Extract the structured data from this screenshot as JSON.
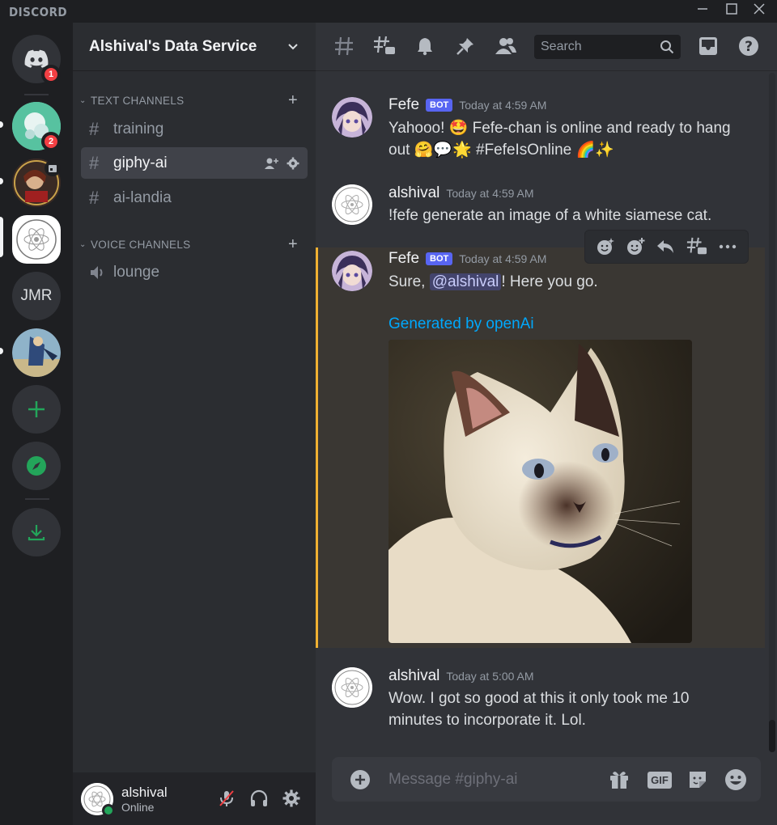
{
  "titlebar": {
    "brand": "DISCORD"
  },
  "servers": {
    "home_badge": "1",
    "server2_badge": "2",
    "jmr_label": "JMR"
  },
  "guild": {
    "name": "Alshival's Data Service"
  },
  "categories": {
    "text": "TEXT CHANNELS",
    "voice": "VOICE CHANNELS"
  },
  "channels": {
    "training": "training",
    "giphy_ai": "giphy-ai",
    "ai_landia": "ai-landia",
    "lounge": "lounge"
  },
  "user": {
    "name": "alshival",
    "status": "Online"
  },
  "topbar": {
    "search_placeholder": "Search"
  },
  "messages": [
    {
      "author": "Fefe",
      "bot": "BOT",
      "time": "Today at 4:59 AM",
      "text": "Yahooo! 🤩 Fefe-chan is online and ready to hang out 🤗💬🌟 #FefeIsOnline 🌈✨"
    },
    {
      "author": "alshival",
      "time": "Today at 4:59 AM",
      "text": "!fefe generate an image of a white siamese cat."
    },
    {
      "author": "Fefe",
      "bot": "BOT",
      "time": "Today at 4:59 AM",
      "text_pre": "Sure, ",
      "mention": "@alshival",
      "text_post": "! Here you go.",
      "embed_title": "Generated by openAi"
    },
    {
      "author": "alshival",
      "time": "Today at 5:00 AM",
      "text": "Wow. I got so good at this it only took me 10 minutes to incorporate it. Lol."
    }
  ],
  "composer": {
    "placeholder": "Message #giphy-ai",
    "gif_label": "GIF"
  },
  "colors": {
    "accent": "#5865f2",
    "highlight_border": "#f0b132",
    "online": "#23a55a",
    "badge": "#f23f43",
    "link": "#00a8fc"
  }
}
